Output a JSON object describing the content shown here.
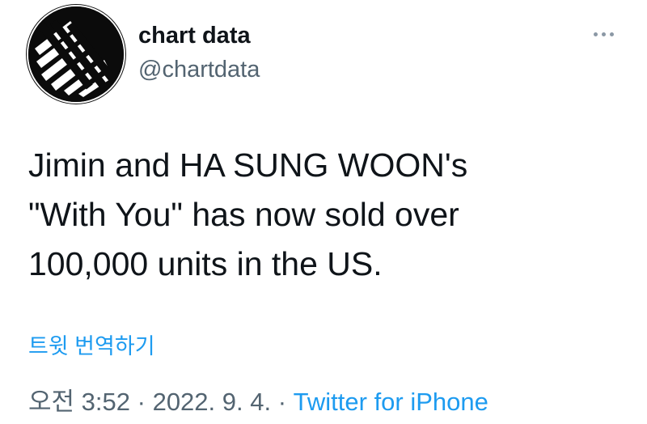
{
  "author": {
    "avatar_icon": "chart-data-logo-icon",
    "display_name": "chart data",
    "handle": "@chartdata"
  },
  "tweet": {
    "lines": [
      "Jimin and HA SUNG WOON's",
      "\"With You\" has now sold over",
      "100,000 units in the US."
    ],
    "translate_label": "트윗 번역하기",
    "time": "오전 3:52",
    "separator": "·",
    "date": "2022. 9. 4.",
    "source": "Twitter for iPhone"
  },
  "menu": {
    "icon": "more-horizontal-icon"
  },
  "colors": {
    "accent": "#1d9bf0",
    "text": "#0f1419",
    "secondary": "#536471"
  }
}
